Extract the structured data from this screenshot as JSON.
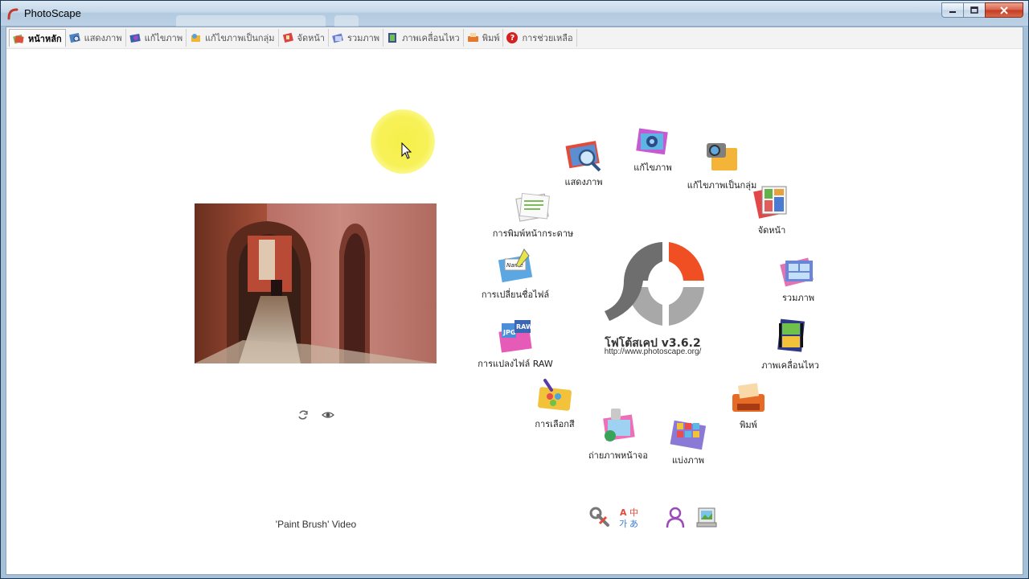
{
  "window": {
    "title": "PhotoScape"
  },
  "tabs": [
    {
      "label": "หน้าหลัก",
      "icon": "home-icon",
      "active": true
    },
    {
      "label": "แสดงภาพ",
      "icon": "viewer-icon"
    },
    {
      "label": "แก้ไขภาพ",
      "icon": "editor-icon"
    },
    {
      "label": "แก้ไขภาพเป็นกลุ่ม",
      "icon": "batch-editor-icon"
    },
    {
      "label": "จัดหน้า",
      "icon": "page-icon"
    },
    {
      "label": "รวมภาพ",
      "icon": "combine-icon"
    },
    {
      "label": "ภาพเคลื่อนไหว",
      "icon": "animated-gif-icon"
    },
    {
      "label": "พิมพ์",
      "icon": "print-icon"
    },
    {
      "label": "การช่วยเหลือ",
      "icon": "help-icon"
    }
  ],
  "left_panel": {
    "caption": "'Paint Brush' Video"
  },
  "wheel": {
    "viewer": "แสดงภาพ",
    "editor": "แก้ไขภาพ",
    "batch_editor": "แก้ไขภาพเป็นกลุ่ม",
    "page": "จัดหน้า",
    "combine": "รวมภาพ",
    "animated_gif": "ภาพเคลื่อนไหว",
    "print": "พิมพ์",
    "splitter": "แบ่งภาพ",
    "screen_capture": "ถ่ายภาพหน้าจอ",
    "color_picker": "การเลือกสี",
    "raw_converter": "การแปลงไฟล์ RAW",
    "rename": "การเปลี่ยนชื่อไฟล์",
    "paper_print": "การพิมพ์หน้ากระดาษ"
  },
  "logo": {
    "title": "โฟโต้สเคป v3.6.2",
    "url": "http://www.photoscape.org/"
  },
  "bottom_icons": [
    "tools-icon",
    "language-icon",
    "user-icon",
    "wallpaper-icon"
  ],
  "colors": {
    "logo_red": "#f04e23",
    "logo_gray": "#6e6e6e",
    "cursor_highlight": "#f6f04a"
  }
}
